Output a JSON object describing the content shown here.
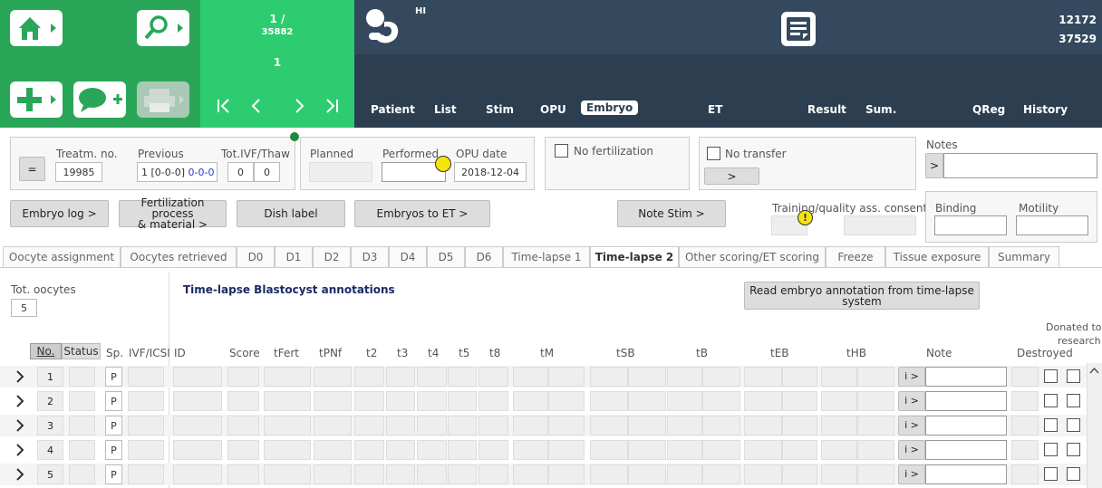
{
  "header": {
    "counter_top": "1 /",
    "counter_total": "35882",
    "counter_current": "1",
    "patient_code": "HI",
    "id_top": "12172",
    "id_bottom": "37529"
  },
  "nav_tabs": [
    "Patient",
    "List",
    "Stim",
    "OPU",
    "Embryo",
    "ET",
    "Result",
    "Sum.",
    "QReg",
    "History"
  ],
  "treatment": {
    "equals_btn": "=",
    "treatm_label": "Treatm. no.",
    "treatm_value": "19985",
    "previous_label": "Previous",
    "previous_value_a": "1 [0-0-0]",
    "previous_value_b": "0-0-0",
    "tot_label": "Tot.IVF/Thaw",
    "tot_ivf": "0",
    "tot_thaw": "0"
  },
  "opu": {
    "planned_label": "Planned",
    "performed_label": "Performed",
    "opu_date_label": "OPU date",
    "opu_date_value": "2018-12-04"
  },
  "no_fertilization": "No fertilization",
  "no_transfer": "No transfer",
  "no_transfer_btn": ">",
  "notes_label": "Notes",
  "notes_btn": ">",
  "buttons": {
    "embryo_log": "Embryo log >",
    "fert_line1": "Fertilization process",
    "fert_line2": "& material >",
    "dish_label": "Dish label",
    "embryos_to_et": "Embryos to ET >",
    "note_stim": "Note Stim >"
  },
  "training_label": "Training/quality ass. consent",
  "binding_label": "Binding",
  "motility_label": "Motility",
  "tabs": [
    "Oocyte assignment",
    "Oocytes retrieved",
    "D0",
    "D1",
    "D2",
    "D3",
    "D4",
    "D5",
    "D6",
    "Time-lapse 1",
    "Time-lapse 2",
    "Other scoring/ET scoring",
    "Freeze",
    "Tissue exposure",
    "Summary"
  ],
  "tot_oocytes_label": "Tot. oocytes",
  "tot_oocytes_value": "5",
  "section_title": "Time-lapse Blastocyst annotations",
  "read_btn_line1": "Read embryo annotation from time-lapse",
  "read_btn_line2": "system",
  "donated_line1": "Donated to",
  "donated_line2": "research",
  "columns": {
    "no": "No.",
    "status": "Status",
    "sp": "Sp.",
    "ivf": "IVF/ICSI",
    "id": "ID",
    "score": "Score",
    "tfert": "tFert",
    "tpnf": "tPNf",
    "t2": "t2",
    "t3": "t3",
    "t4": "t4",
    "t5": "t5",
    "t8": "t8",
    "tm": "tM",
    "tsb": "tSB",
    "tb": "tB",
    "teb": "tEB",
    "thb": "tHB",
    "note": "Note",
    "destroyed": "Destroyed"
  },
  "rows": [
    {
      "no": "1",
      "sp": "P"
    },
    {
      "no": "2",
      "sp": "P"
    },
    {
      "no": "3",
      "sp": "P"
    },
    {
      "no": "4",
      "sp": "P"
    },
    {
      "no": "5",
      "sp": "P"
    }
  ],
  "row_note_btn": "i >",
  "icons": [
    "home-icon",
    "search-icon",
    "add-icon",
    "comment-add-icon",
    "print-icon",
    "first-icon",
    "prev-icon",
    "next-icon",
    "last-icon",
    "baby-icon",
    "document-icon"
  ],
  "colors": {
    "green_dark": "#2aa659",
    "green_light": "#2ecc71",
    "navy": "#2c3e50",
    "warning_yellow": "#f5e50a"
  }
}
